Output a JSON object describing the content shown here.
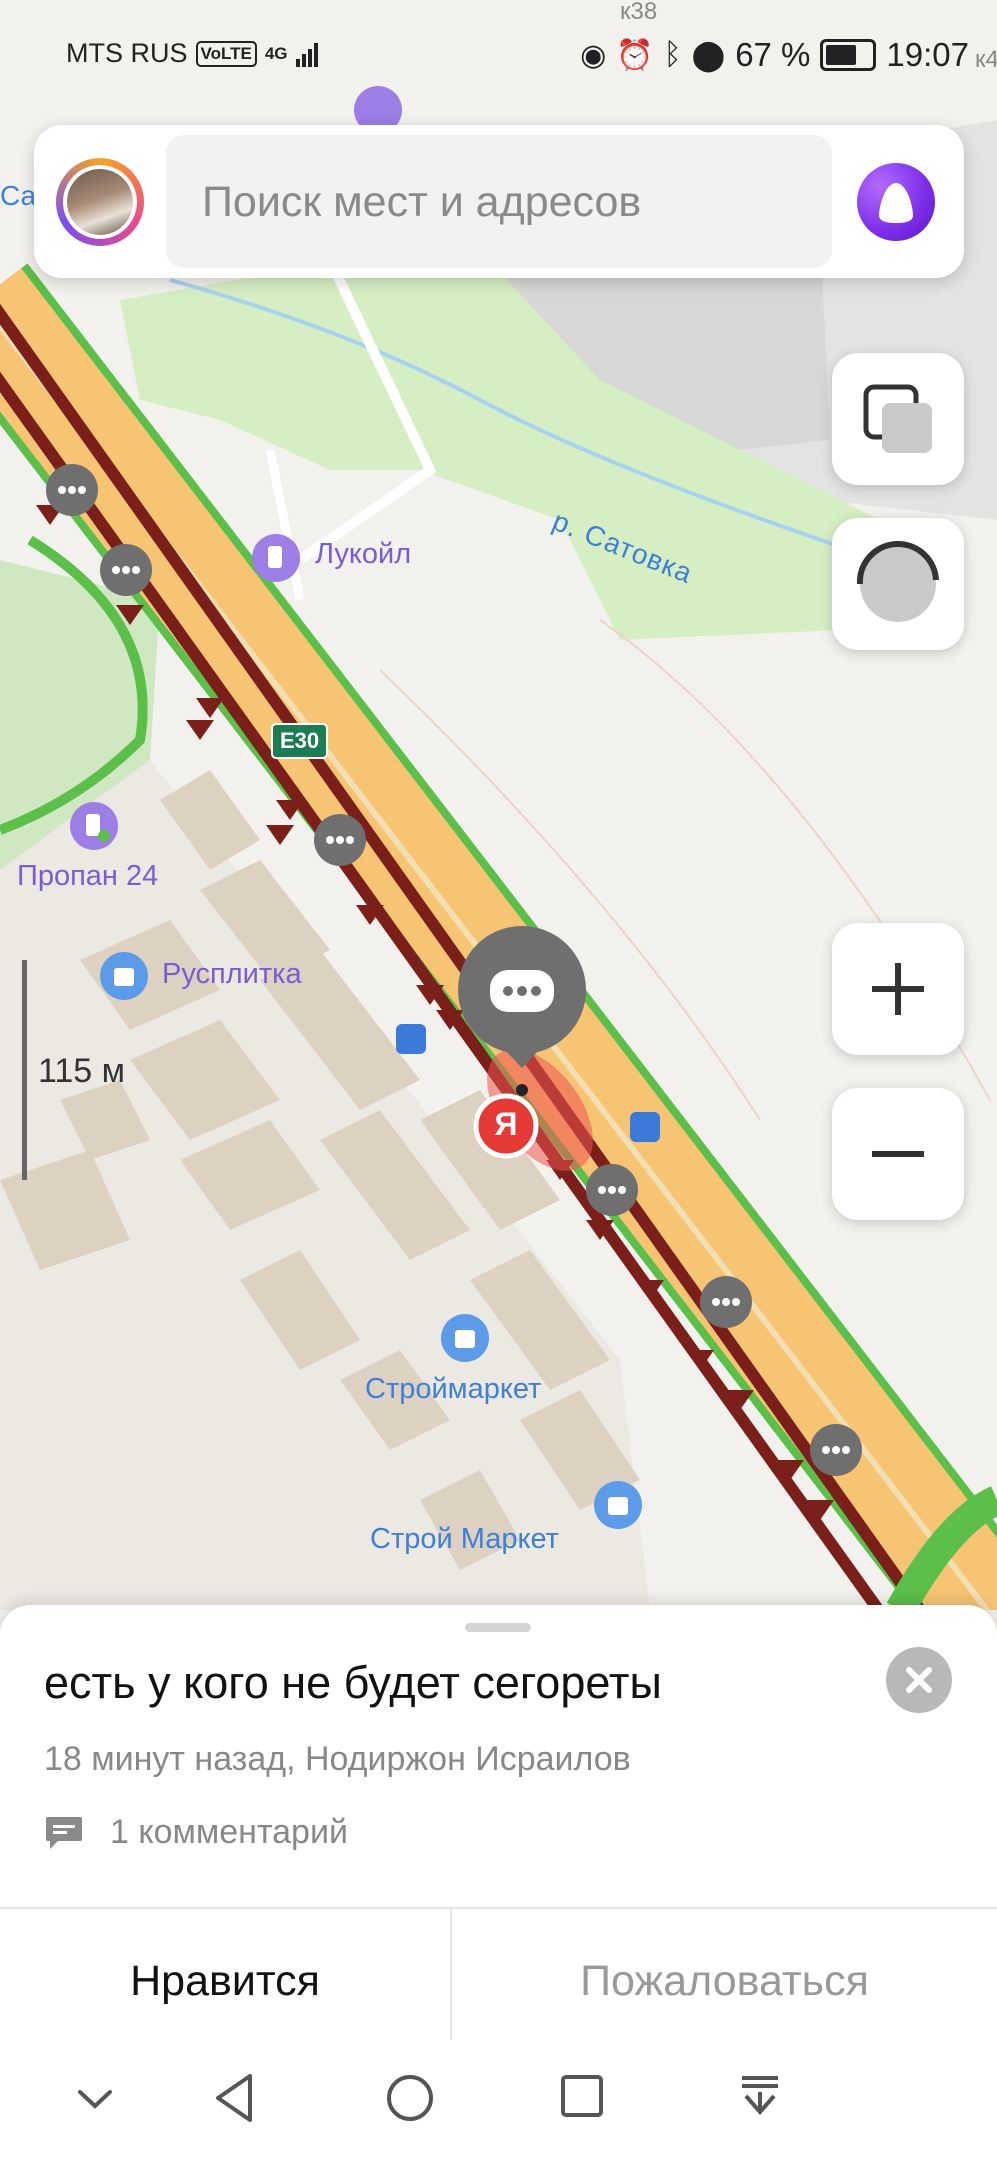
{
  "status_bar": {
    "carrier": "MTS RUS",
    "volte": "VoLTE",
    "network": "4G",
    "battery_percent": "67 %",
    "time": "19:07"
  },
  "search": {
    "placeholder": "Поиск мест и адресов"
  },
  "map": {
    "labels": {
      "river": "р. Сатовка",
      "lukoil": "Лукойл",
      "road_shield": "E30",
      "propan": "Пропан 24",
      "rusplitka": "Русплитка",
      "stroymarket1": "Строймаркет",
      "stroymarket2": "Строй Маркет",
      "yandex_pin": "Я",
      "corner_left": "Са",
      "corner_top": "к38",
      "corner_right": "к4"
    },
    "scale": "115 м"
  },
  "event": {
    "title": "есть у кого не будет сегореты",
    "meta": "18 минут назад, Нодиржон Исраилов",
    "comments": "1 комментарий",
    "like_label": "Нравится",
    "report_label": "Пожаловаться"
  },
  "colors": {
    "traffic_jam": "#7a1f1a",
    "road_fill": "#f6c473",
    "road_edge": "#5bbf4a",
    "accent_alice": "#7b2de6",
    "poi_label": "#7a5dd1",
    "shop_label": "#3f7fd6"
  },
  "icons": {
    "layers": "layers-icon",
    "location": "compass-icon",
    "zoom_in": "plus-icon",
    "zoom_out": "minus-icon",
    "close": "close-icon",
    "comment": "comment-icon",
    "nav_down": "chevron-down-icon",
    "nav_back": "back-triangle-icon",
    "nav_home": "home-circle-icon",
    "nav_recent": "recent-square-icon",
    "nav_notifications": "pull-down-icon"
  }
}
